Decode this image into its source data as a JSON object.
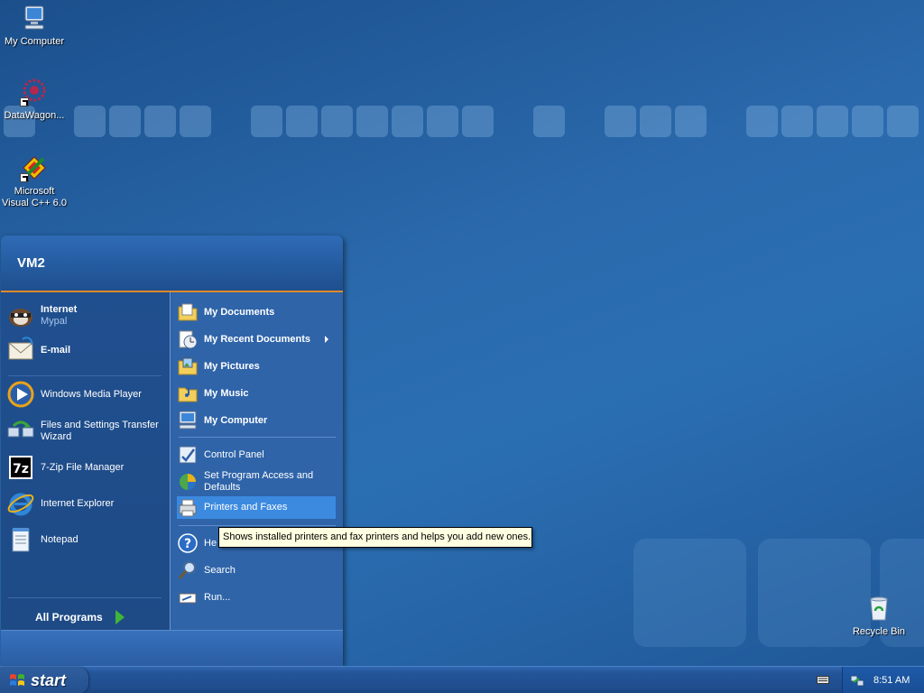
{
  "desktop": {
    "icons": [
      {
        "label": "My Computer"
      },
      {
        "label": "DataWagon..."
      },
      {
        "label": "Microsoft Visual C++ 6.0"
      },
      {
        "label": "Recycle Bin"
      }
    ]
  },
  "start_menu": {
    "user": "VM2",
    "pinned": [
      {
        "title": "Internet",
        "subtitle": "Mypal"
      },
      {
        "title": "E-mail",
        "subtitle": ""
      }
    ],
    "recent": [
      {
        "label": "Windows Media Player"
      },
      {
        "label": "Files and Settings Transfer Wizard"
      },
      {
        "label": "7-Zip File Manager"
      },
      {
        "label": "Internet Explorer"
      },
      {
        "label": "Notepad"
      }
    ],
    "all_programs": "All Programs",
    "places": [
      {
        "label": "My Documents"
      },
      {
        "label": "My Recent Documents"
      },
      {
        "label": "My Pictures"
      },
      {
        "label": "My Music"
      },
      {
        "label": "My Computer"
      }
    ],
    "system": [
      {
        "label": "Control Panel"
      },
      {
        "label": "Set Program Access and Defaults"
      },
      {
        "label": "Printers and Faxes"
      },
      {
        "label": "Help and Support"
      },
      {
        "label": "Search"
      },
      {
        "label": "Run..."
      }
    ],
    "help_visible": "He"
  },
  "tooltip": {
    "text": "Shows installed printers and fax printers and helps you add new ones."
  },
  "taskbar": {
    "start_label": "start",
    "clock": "8:51 AM"
  },
  "colors": {
    "selected": "#3c8ae0",
    "tooltip_bg": "#ffffe1",
    "header_accent": "#e08a2a"
  },
  "icons": {
    "my_computer": "monitor-icon",
    "recycle_bin": "recycle-bin-icon",
    "tray_network": "network-icon",
    "tray_keyboard": "keyboard-icon"
  }
}
